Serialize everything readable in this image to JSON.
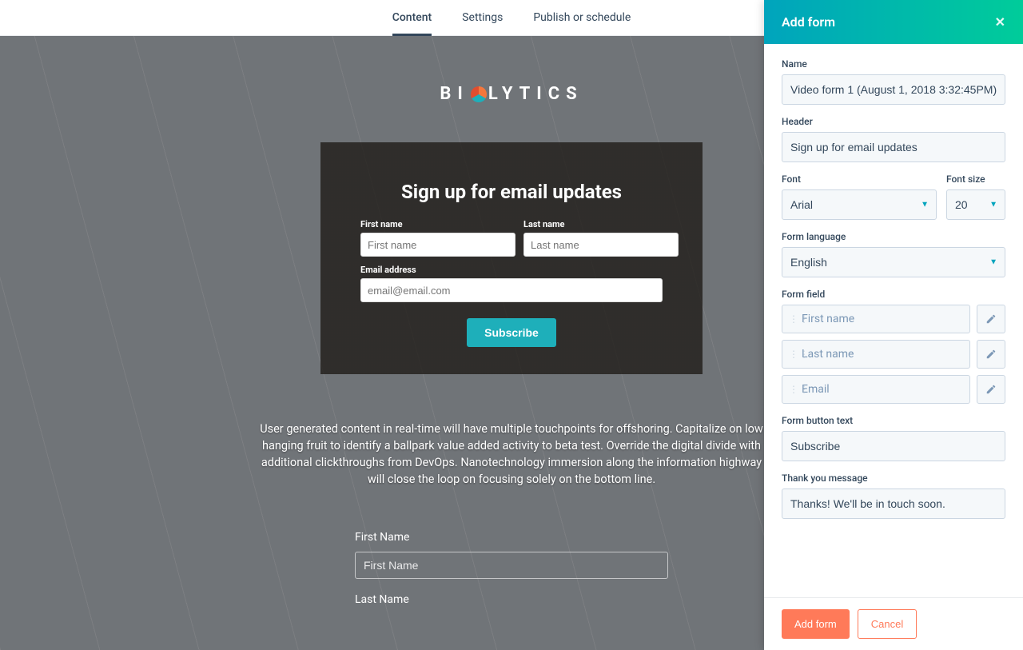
{
  "tabs": {
    "content": "Content",
    "settings": "Settings",
    "publish": "Publish or schedule"
  },
  "preview": {
    "brand_left": "BI",
    "brand_right": "LYTICS",
    "signup_title": "Sign up for email updates",
    "first_name_label": "First name",
    "first_name_ph": "First name",
    "last_name_label": "Last name",
    "last_name_ph": "Last name",
    "email_label": "Email address",
    "email_ph": "email@email.com",
    "subscribe_btn": "Subscribe",
    "lorem": "User generated content in real-time will have multiple touchpoints for offshoring. Capitalize on low hanging fruit to identify a ballpark value added activity to beta test. Override the digital divide with additional clickthroughs from DevOps. Nanotechnology immersion along the information highway will close the loop on focusing solely on the bottom line.",
    "lower_first_label": "First Name",
    "lower_first_ph": "First Name",
    "lower_last_label": "Last Name"
  },
  "panel": {
    "title": "Add form",
    "name_label": "Name",
    "name_value": "Video form 1 (August 1, 2018 3:32:45PM)",
    "header_label": "Header",
    "header_value": "Sign up for email updates",
    "font_label": "Font",
    "font_value": "Arial",
    "fontsize_label": "Font size",
    "fontsize_value": "20",
    "lang_label": "Form language",
    "lang_value": "English",
    "formfield_label": "Form field",
    "ff_first": "First name",
    "ff_last": "Last name",
    "ff_email": "Email",
    "buttontext_label": "Form button text",
    "buttontext_value": "Subscribe",
    "thankyou_label": "Thank you message",
    "thankyou_value": "Thanks! We'll be in touch soon.",
    "add_btn": "Add form",
    "cancel_btn": "Cancel"
  }
}
